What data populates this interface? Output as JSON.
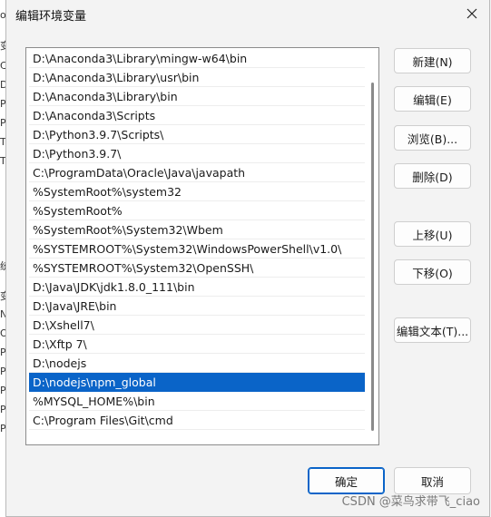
{
  "background_window": {
    "fragments": [
      "ol",
      "变",
      "CL",
      "Dr",
      "Pa",
      "Py",
      "TE",
      "TM",
      "统",
      "变",
      "NI",
      "OS",
      "Pa",
      "PA",
      "PF",
      "PF",
      "PF"
    ]
  },
  "dialog": {
    "title": "编辑环境变量",
    "path_entries": [
      "D:\\Anaconda3\\Library\\mingw-w64\\bin",
      "D:\\Anaconda3\\Library\\usr\\bin",
      "D:\\Anaconda3\\Library\\bin",
      "D:\\Anaconda3\\Scripts",
      "D:\\Python3.9.7\\Scripts\\",
      "D:\\Python3.9.7\\",
      "C:\\ProgramData\\Oracle\\Java\\javapath",
      "%SystemRoot%\\system32",
      "%SystemRoot%",
      "%SystemRoot%\\System32\\Wbem",
      "%SYSTEMROOT%\\System32\\WindowsPowerShell\\v1.0\\",
      "%SYSTEMROOT%\\System32\\OpenSSH\\",
      "D:\\Java\\JDK\\jdk1.8.0_111\\bin",
      "D:\\Java\\JRE\\bin",
      "D:\\Xshell7\\",
      "D:\\Xftp 7\\",
      "D:\\nodejs",
      "D:\\nodejs\\npm_global",
      "%MYSQL_HOME%\\bin",
      "C:\\Program Files\\Git\\cmd"
    ],
    "selected_index": 17,
    "buttons": {
      "new": "新建(N)",
      "edit": "编辑(E)",
      "browse": "浏览(B)...",
      "delete": "删除(D)",
      "move_up": "上移(U)",
      "move_down": "下移(O)",
      "edit_text": "编辑文本(T)...",
      "ok": "确定",
      "cancel": "取消"
    },
    "accent_color": "#0a64c8"
  },
  "watermark": "CSDN @菜鸟求带飞_ciao"
}
